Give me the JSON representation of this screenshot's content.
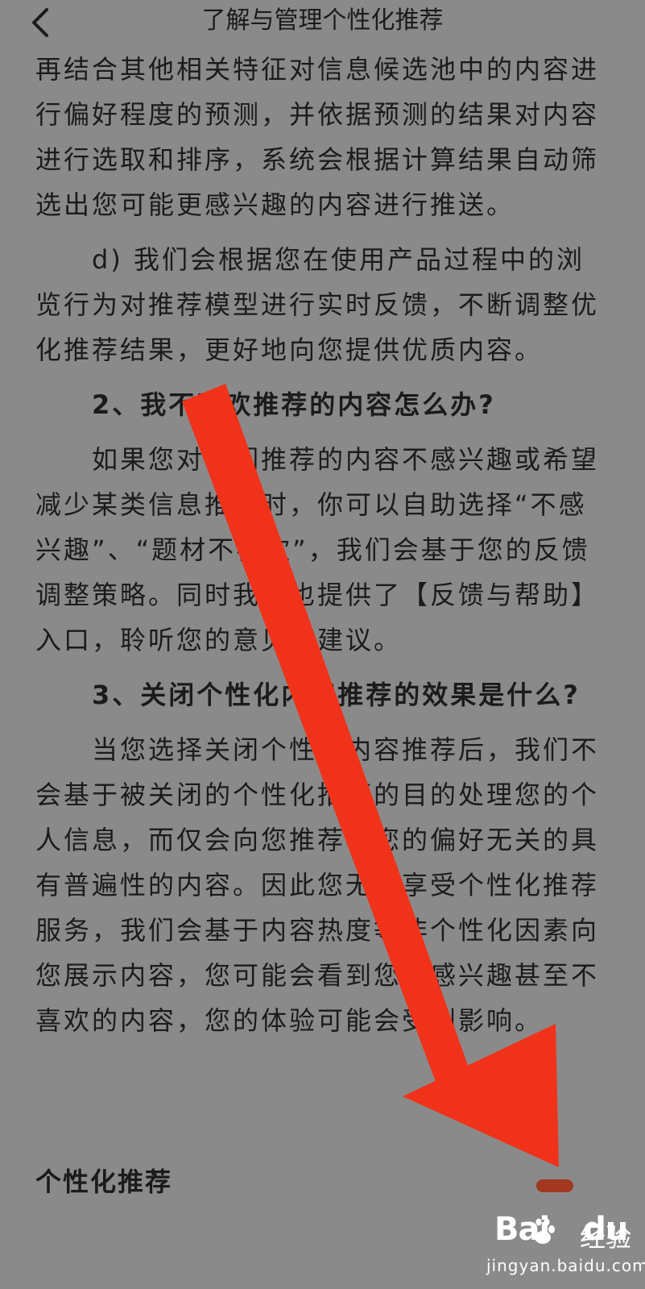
{
  "header": {
    "title": "了解与管理个性化推荐",
    "back_icon": "chevron-left-icon"
  },
  "content": {
    "para_intro": "再结合其他相关特征对信息候选池中的内容进行偏好程度的预测，并依据预测的结果对内容进行选取和排序，系统会根据计算结果自动筛选出您可能更感兴趣的内容进行推送。",
    "para_d": "d) 我们会根据您在使用产品过程中的浏览行为对推荐模型进行实时反馈，不断调整优化推荐结果，更好地向您提供优质内容。",
    "heading_2": "2、我不喜欢推荐的内容怎么办?",
    "para_2": "如果您对我们推荐的内容不感兴趣或希望减少某类信息推荐时，你可以自助选择“不感兴趣”、“题材不喜欢”，我们会基于您的反馈调整策略。同时我们也提供了【反馈与帮助】入口，聆听您的意见和建议。",
    "heading_3": "3、关闭个性化内容推荐的效果是什么?",
    "para_3": "当您选择关闭个性化内容推荐后，我们不会基于被关闭的个性化推荐的目的处理您的个人信息，而仅会向您推荐与您的偏好无关的具有普遍性的内容。因此您无法享受个性化推荐服务，我们会基于内容热度等非个性化因素向您展示内容，您可能会看到您不感兴趣甚至不喜欢的内容，您的体验可能会受到影响。"
  },
  "setting": {
    "label": "个性化推荐",
    "toggle_state": "on",
    "toggle_color": "#a2381f"
  },
  "annotation": {
    "arrow_color": "#f0321a",
    "arrow_icon": "arrow-down-right-icon"
  },
  "watermark": {
    "logo_text": "Bai",
    "logo_text_2": "du",
    "paw_icon": "baidu-paw-icon",
    "sub_text": "经验",
    "url": "jingyan.baidu.com"
  }
}
